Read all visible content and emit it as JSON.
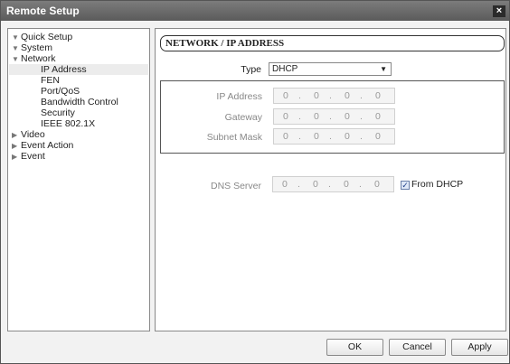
{
  "window": {
    "title": "Remote Setup",
    "close_label": "×"
  },
  "tree": {
    "items": [
      {
        "label": "Quick Setup",
        "arrow": "▼"
      },
      {
        "label": "System",
        "arrow": "▼"
      },
      {
        "label": "Network",
        "arrow": "▼"
      },
      {
        "label": "IP Address",
        "arrow": ""
      },
      {
        "label": "FEN",
        "arrow": ""
      },
      {
        "label": "Port/QoS",
        "arrow": ""
      },
      {
        "label": "Bandwidth Control",
        "arrow": ""
      },
      {
        "label": "Security",
        "arrow": ""
      },
      {
        "label": "IEEE 802.1X",
        "arrow": ""
      },
      {
        "label": "Video",
        "arrow": "▶"
      },
      {
        "label": "Event Action",
        "arrow": "▶"
      },
      {
        "label": "Event",
        "arrow": "▶"
      }
    ],
    "selected": "IP Address"
  },
  "panel": {
    "title": "NETWORK / IP ADDRESS",
    "type_label": "Type",
    "type_value": "DHCP",
    "ip_address_label": "IP Address",
    "gateway_label": "Gateway",
    "subnet_mask_label": "Subnet Mask",
    "dns_server_label": "DNS Server",
    "from_dhcp_label": "From DHCP",
    "from_dhcp_checked": true,
    "ip_address": [
      "0",
      "0",
      "0",
      "0"
    ],
    "gateway": [
      "0",
      "0",
      "0",
      "0"
    ],
    "subnet_mask": [
      "0",
      "0",
      "0",
      "0"
    ],
    "dns_server": [
      "0",
      "0",
      "0",
      "0"
    ]
  },
  "buttons": {
    "ok": "OK",
    "cancel": "Cancel",
    "apply": "Apply"
  },
  "colors": {
    "titlebar": "#6a6a6a",
    "checkbox_accent": "#1d3f8a"
  }
}
